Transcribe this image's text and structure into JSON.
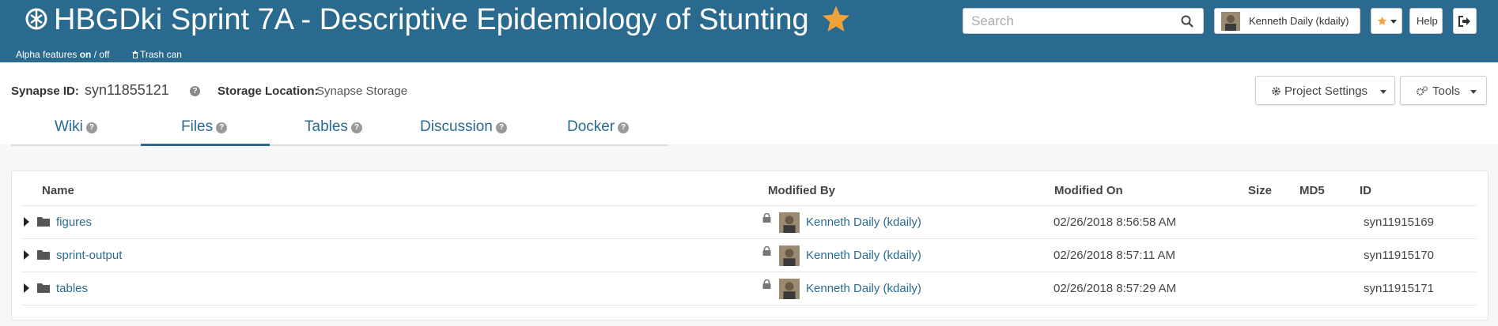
{
  "header": {
    "project_title": "HBGDki Sprint 7A - Descriptive Epidemiology of Stunting",
    "alpha_prefix": "Alpha features ",
    "alpha_on": "on",
    "alpha_suffix": " / off",
    "trash_label": "Trash can",
    "search_placeholder": "Search",
    "user_label": "Kenneth Daily (kdaily)",
    "help_label": "Help",
    "accent_color": "#2a6a8f",
    "star_color": "#f0a33a"
  },
  "project": {
    "synapse_id_label": "Synapse ID:",
    "synapse_id": "syn11855121",
    "storage_location_label": "Storage Location:",
    "storage_location": "Synapse Storage",
    "project_settings_label": "Project Settings",
    "tools_label": "Tools"
  },
  "tabs": [
    {
      "label": "Wiki",
      "active": false
    },
    {
      "label": "Files",
      "active": true
    },
    {
      "label": "Tables",
      "active": false
    },
    {
      "label": "Discussion",
      "active": false
    },
    {
      "label": "Docker",
      "active": false
    }
  ],
  "table": {
    "columns": [
      "Name",
      "Modified By",
      "Modified On",
      "Size",
      "MD5",
      "ID"
    ],
    "rows": [
      {
        "name": "figures",
        "modified_by": "Kenneth Daily (kdaily)",
        "modified_on": "02/26/2018 8:56:58 AM",
        "size": "",
        "md5": "",
        "id": "syn11915169"
      },
      {
        "name": "sprint-output",
        "modified_by": "Kenneth Daily (kdaily)",
        "modified_on": "02/26/2018 8:57:11 AM",
        "size": "",
        "md5": "",
        "id": "syn11915170"
      },
      {
        "name": "tables",
        "modified_by": "Kenneth Daily (kdaily)",
        "modified_on": "02/26/2018 8:57:29 AM",
        "size": "",
        "md5": "",
        "id": "syn11915171"
      }
    ]
  }
}
